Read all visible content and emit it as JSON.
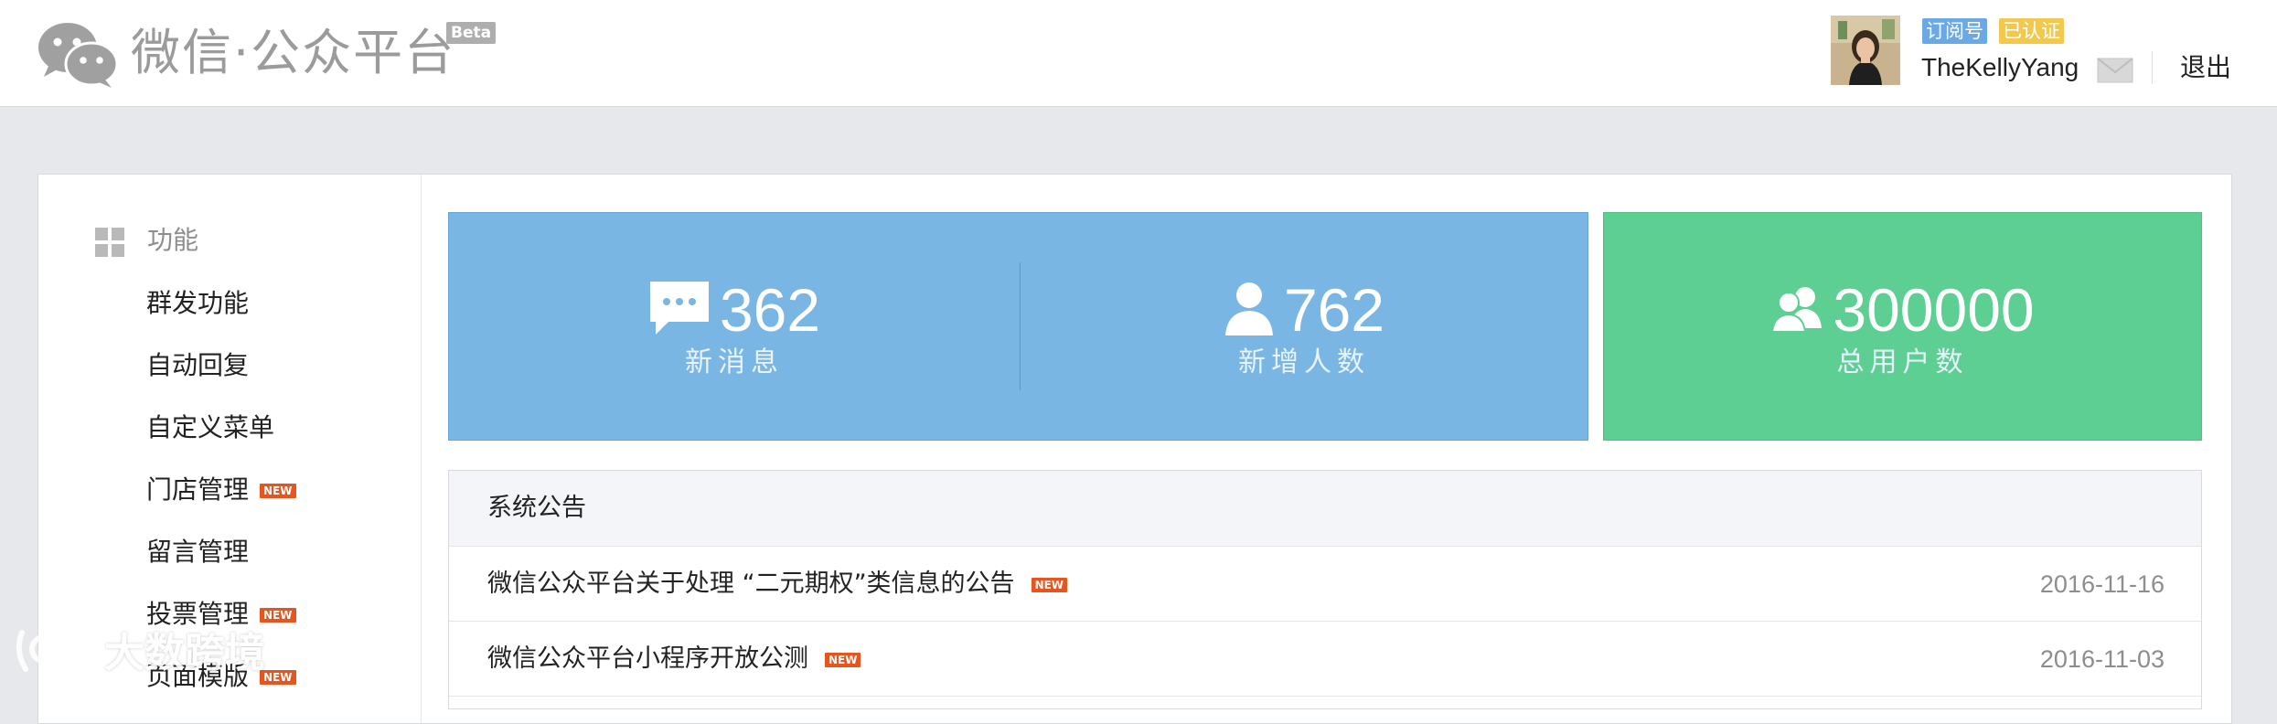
{
  "header": {
    "logo_text": "微信·公众平台",
    "beta_label": "Beta",
    "account_tags": [
      "订阅号",
      "已认证"
    ],
    "username": "TheKellyYang",
    "logout_label": "退出"
  },
  "sidebar": {
    "section_title": "功能",
    "items": [
      {
        "label": "群发功能",
        "new": false
      },
      {
        "label": "自动回复",
        "new": false
      },
      {
        "label": "自定义菜单",
        "new": false
      },
      {
        "label": "门店管理",
        "new": true
      },
      {
        "label": "留言管理",
        "new": false
      },
      {
        "label": "投票管理",
        "new": true
      },
      {
        "label": "页面模版",
        "new": true
      }
    ],
    "new_badge": "NEW"
  },
  "stats": {
    "new_messages": {
      "value": "362",
      "label": "新消息",
      "icon": "message-icon"
    },
    "new_followers": {
      "value": "762",
      "label": "新增人数",
      "icon": "user-icon"
    },
    "total_users": {
      "value": "300000",
      "label": "总用户数",
      "icon": "users-icon"
    }
  },
  "notices": {
    "title": "系统公告",
    "items": [
      {
        "text": "微信公众平台关于处理 “二元期权”类信息的公告",
        "new": true,
        "date": "2016-11-16"
      },
      {
        "text": "微信公众平台小程序开放公测",
        "new": true,
        "date": "2016-11-03"
      }
    ]
  },
  "watermark": "大数跨境",
  "colors": {
    "stat_blue": "#7ab6e4",
    "stat_green": "#5ecf93",
    "new_badge": "#e8541e",
    "tag_subscribe": "#6aa8e6",
    "tag_verified": "#f2c94c"
  }
}
